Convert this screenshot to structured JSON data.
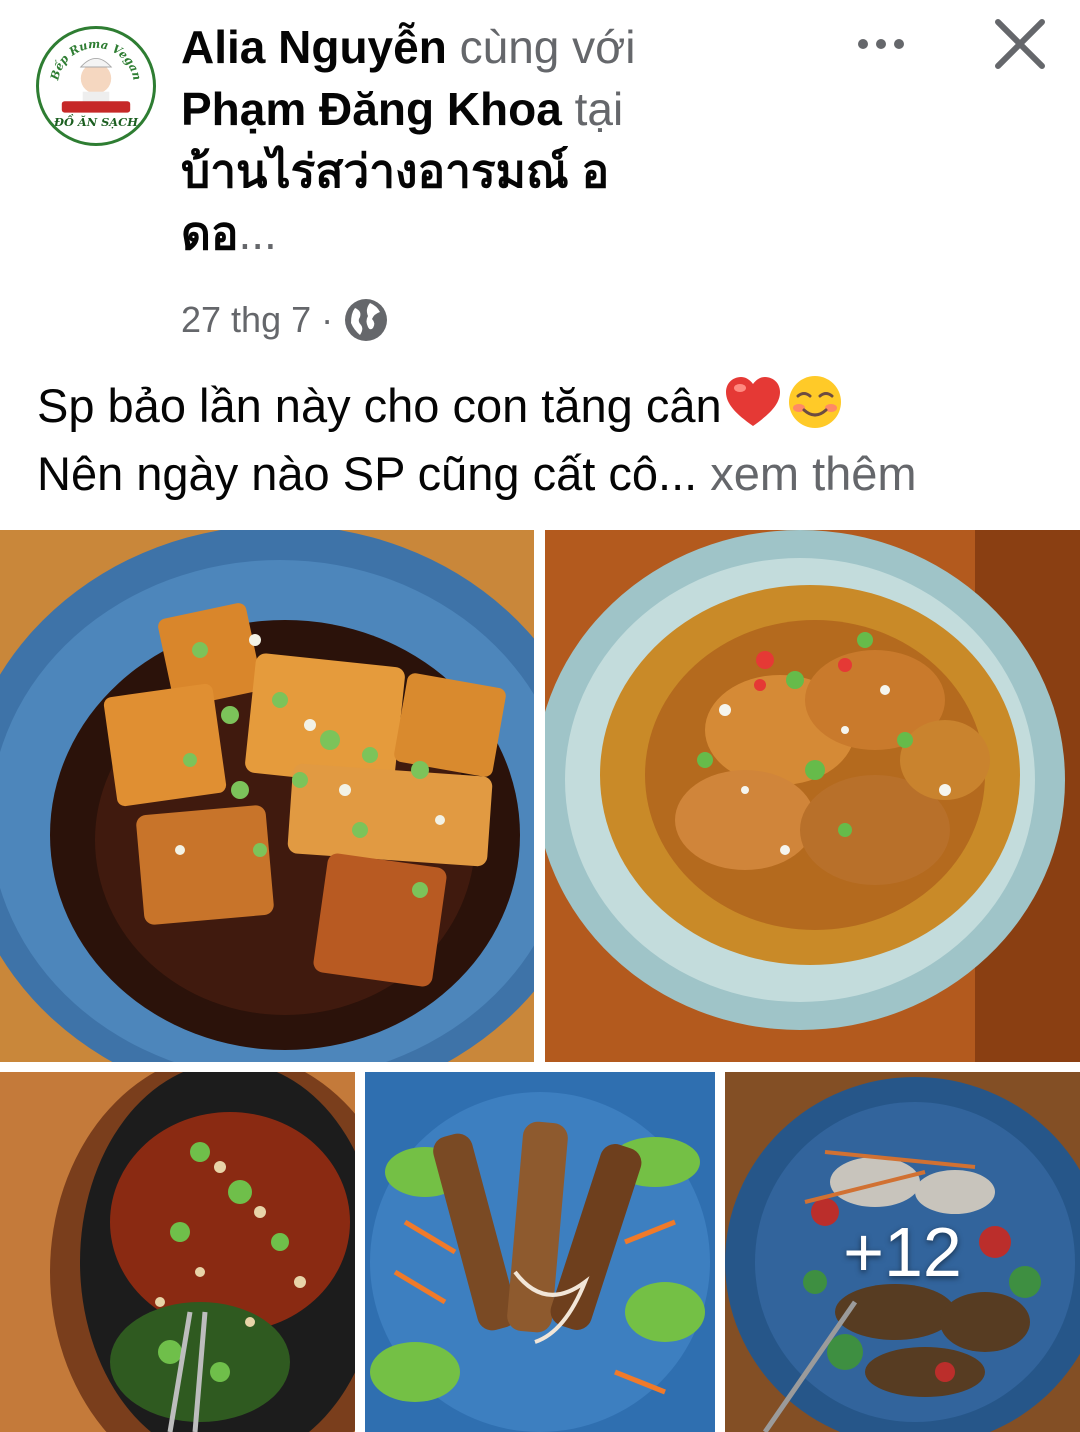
{
  "post": {
    "author": "Alia Nguyễn",
    "with_word": "cùng với",
    "tagged": "Phạm Đăng Khoa",
    "at_word": "tại",
    "location_line1": "บ้านไร่สว่างอารมณ์ อ",
    "location_line2": "ดอ",
    "location_ellipsis": "...",
    "date": "27 thg 7",
    "separator": "·",
    "privacy_icon": "globe-icon",
    "caption_line1": "Sp bảo lần này cho con tăng cân",
    "caption_line2": "Nên ngày nào SP cũng cất cô...",
    "see_more": "xem thêm",
    "more_photos": "+12"
  },
  "avatar_logo": {
    "top_text": "Bếp Ruma Vegan",
    "bottom_text": "ĐỒ ĂN SẠCH",
    "colors": {
      "ring": "#2e7d32",
      "banner": "#c62828"
    }
  },
  "colors": {
    "text_primary": "#050505",
    "text_secondary": "#65676b",
    "background": "#ffffff"
  }
}
